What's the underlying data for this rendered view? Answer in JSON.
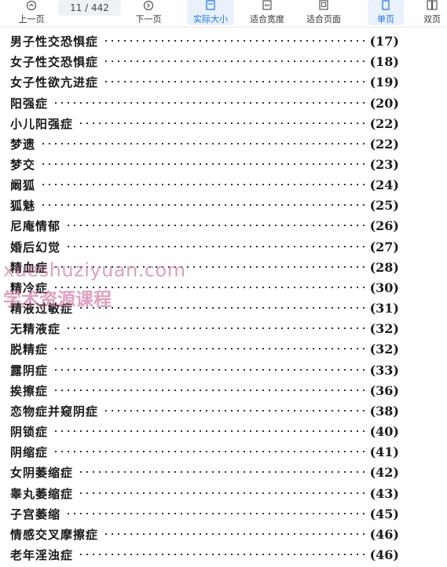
{
  "toolbar": {
    "prev_label": "上一页",
    "page_indicator": "11 / 442",
    "next_label": "下一页",
    "actual_size_label": "实际大小",
    "fit_width_label": "适合宽度",
    "fit_page_label": "适合页面",
    "single_page_label": "单页",
    "double_page_label": "双页"
  },
  "watermark": {
    "line1": "xueshuziyuan.com",
    "line2": "学术资源课程"
  },
  "toc": [
    {
      "title": "男子性交恐惧症",
      "page": "(17)"
    },
    {
      "title": "女子性交恐惧症",
      "page": "(18)"
    },
    {
      "title": "女子性欲亢进症",
      "page": "(19)"
    },
    {
      "title": "阳强症",
      "page": "(20)"
    },
    {
      "title": "小儿阳强症",
      "page": "(22)"
    },
    {
      "title": "梦遗",
      "page": "(22)"
    },
    {
      "title": "梦交",
      "page": "(23)"
    },
    {
      "title": "阚狐",
      "page": "(24)"
    },
    {
      "title": "狐魅",
      "page": "(25)"
    },
    {
      "title": "尼庵情郁",
      "page": "(26)"
    },
    {
      "title": "婚后幻觉",
      "page": "(27)"
    },
    {
      "title": "精血症",
      "page": "(28)"
    },
    {
      "title": "精冷症",
      "page": "(30)"
    },
    {
      "title": "精液过敏症",
      "page": "(31)"
    },
    {
      "title": "无精液症",
      "page": "(32)"
    },
    {
      "title": "脱精症",
      "page": "(32)"
    },
    {
      "title": "露阴症",
      "page": "(33)"
    },
    {
      "title": "挨擦症",
      "page": "(36)"
    },
    {
      "title": "恋物症并窥阴症",
      "page": "(38)"
    },
    {
      "title": "阴锁症",
      "page": "(40)"
    },
    {
      "title": "阴缩症",
      "page": "(41)"
    },
    {
      "title": "女阴萎缩症",
      "page": "(42)"
    },
    {
      "title": "睾丸萎缩症",
      "page": "(43)"
    },
    {
      "title": "子宫萎缩",
      "page": "(45)"
    },
    {
      "title": "情感交叉摩擦症",
      "page": "(46)"
    },
    {
      "title": "老年淫浊症",
      "page": "(46)"
    }
  ]
}
